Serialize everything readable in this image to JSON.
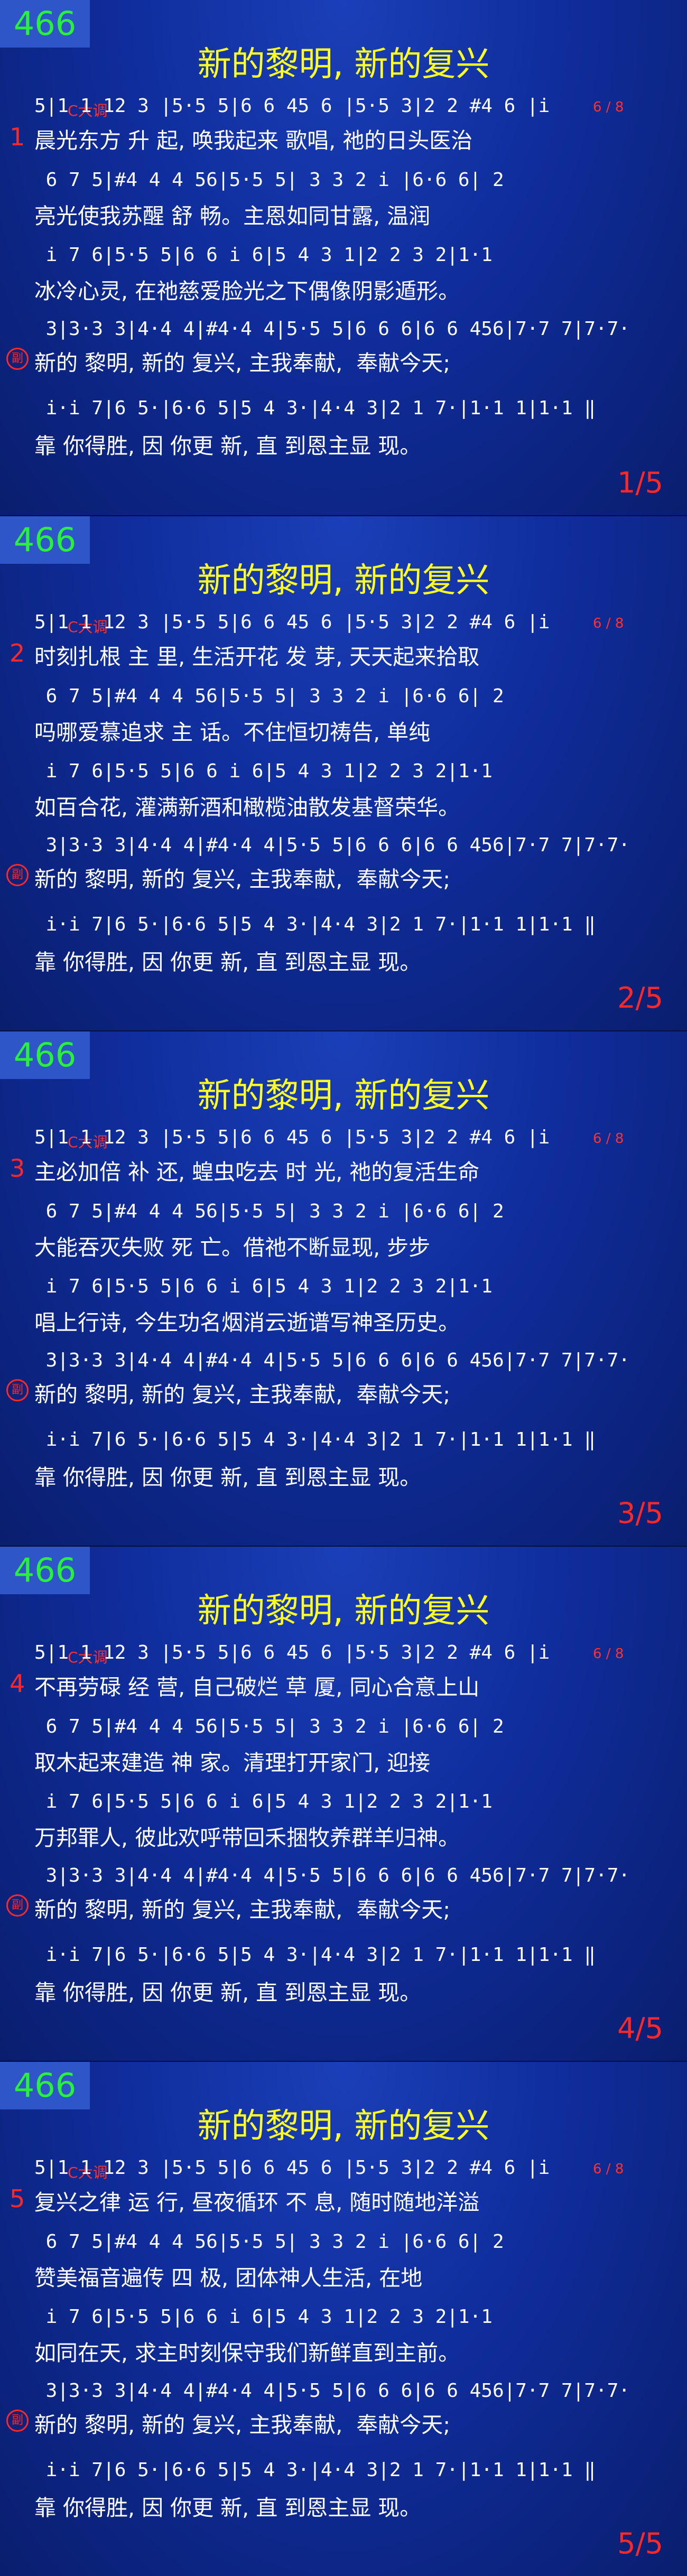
{
  "hymn_number": "466",
  "title": "新的黎明, 新的复兴",
  "key": "C大调",
  "time_signature": "6 / 8",
  "refrain_mark": "副",
  "notes": {
    "line1": "5|1 1 12 3 |5·5 5|6 6 45 6 |5·5 3|2 2 #4 6 |i",
    "line2": " 6 7 5|#4 4 4 56|5·5 5| 3 3 2 i |6·6 6| 2",
    "line3": " i 7 6|5·5 5|6 6 i 6|5 4 3 1|2 2 3 2|1·1",
    "line4": " 3|3·3 3|4·4 4|#4·4 4|5·5 5|6 6 6|6 6 456|7·7 7|7·7·",
    "line5": " i·i 7|6 5·|6·6 5|5 4 3·|4·4 3|2 1 7·|1·1 1|1·1 ‖"
  },
  "verses": [
    {
      "num": "1",
      "l1": "晨光东方 升 起, 唤我起来 歌唱, 祂的日头医治",
      "l2": "亮光使我苏醒 舒 畅。主恩如同甘露, 温润",
      "l3": "冰冷心灵, 在祂慈爱脸光之下偶像阴影遁形。",
      "page": "1/5"
    },
    {
      "num": "2",
      "l1": "时刻扎根 主 里, 生活开花 发 芽, 天天起来拾取",
      "l2": "吗哪爱慕追求 主 话。不住恒切祷告, 单纯",
      "l3": "如百合花, 灌满新酒和橄榄油散发基督荣华。",
      "page": "2/5"
    },
    {
      "num": "3",
      "l1": "主必加倍 补 还, 蝗虫吃去 时 光, 祂的复活生命",
      "l2": "大能吞灭失败 死 亡。借祂不断显现, 步步",
      "l3": "唱上行诗, 今生功名烟消云逝谱写神圣历史。",
      "page": "3/5"
    },
    {
      "num": "4",
      "l1": "不再劳碌 经 营, 自己破烂 草 厦, 同心合意上山",
      "l2": "取木起来建造 神 家。清理打开家门, 迎接",
      "l3": "万邦罪人, 彼此欢呼带回禾捆牧养群羊归神。",
      "page": "4/5"
    },
    {
      "num": "5",
      "l1": "复兴之律 运 行, 昼夜循环 不 息, 随时随地洋溢",
      "l2": "赞美福音遍传 四 极, 团体神人生活, 在地",
      "l3": "如同在天, 求主时刻保守我们新鲜直到主前。",
      "page": "5/5"
    }
  ],
  "refrain": {
    "l1": "新的 黎明, 新的 复兴, 主我奉献,  奉献今天;",
    "l2": "靠 你得胜, 因 你更 新, 直 到恩主显 现。"
  }
}
